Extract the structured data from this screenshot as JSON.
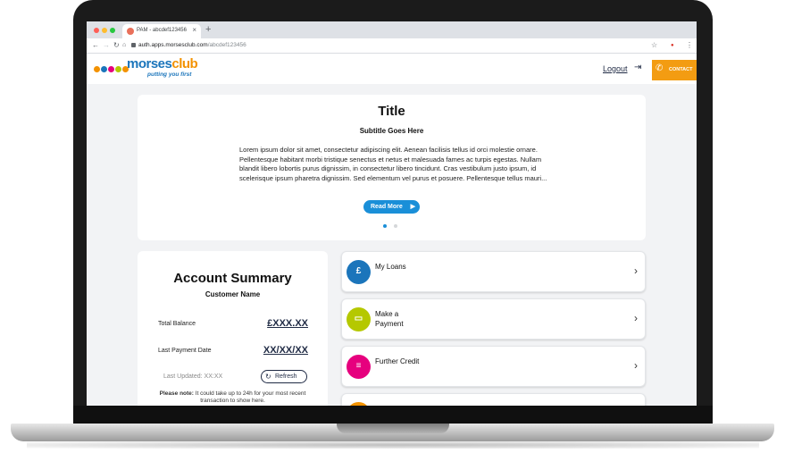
{
  "browser": {
    "tab_title": "PAM - abcdef123456",
    "url_host": "auth.apps.morsesclub.com",
    "url_path": "/abcdef123456"
  },
  "header": {
    "logo_text_a": "morses",
    "logo_text_b": "club",
    "tagline": "putting you first",
    "logout_label": "Logout",
    "contact_label": "CONTACT"
  },
  "hero": {
    "title": "Title",
    "subtitle": "Subtitle Goes Here",
    "body": "Lorem ipsum dolor sit amet, consectetur adipiscing elit. Aenean facilisis tellus id orci molestie ornare. Pellentesque habitant morbi tristique senectus et netus et malesuada fames ac turpis egestas. Nullam blandit libero lobortis purus dignissim, in consectetur libero tincidunt. Cras vestibulum justo ipsum, id scelerisque ipsum pharetra dignissim. Sed elementum vel purus et posuere. Pellentesque tellus mauri...",
    "read_more": "Read More"
  },
  "summary": {
    "title": "Account Summary",
    "customer": "Customer Name",
    "total_balance_label": "Total Balance",
    "total_balance_value": "£XXX.XX",
    "last_payment_label": "Last Payment Date",
    "last_payment_value": "XX/XX/XX",
    "last_updated": "Last Updated: XX:XX",
    "refresh_label": "Refresh",
    "note_bold": "Please note:",
    "note_text": " It could take up to 24h for your most recent transaction to show here."
  },
  "menu": {
    "items": [
      {
        "label": "My Loans",
        "icon": "pound-document-icon",
        "color": "#1b75bb"
      },
      {
        "label": "Make a Payment",
        "icon": "card-icon",
        "color": "#b5c800"
      },
      {
        "label": "Further Credit",
        "icon": "coins-icon",
        "color": "#e6007e"
      }
    ]
  },
  "colors": {
    "brand_blue": "#1b75bb",
    "brand_orange": "#f39200",
    "contact_orange": "#f39c12",
    "read_more_blue": "#1a8fd8"
  }
}
